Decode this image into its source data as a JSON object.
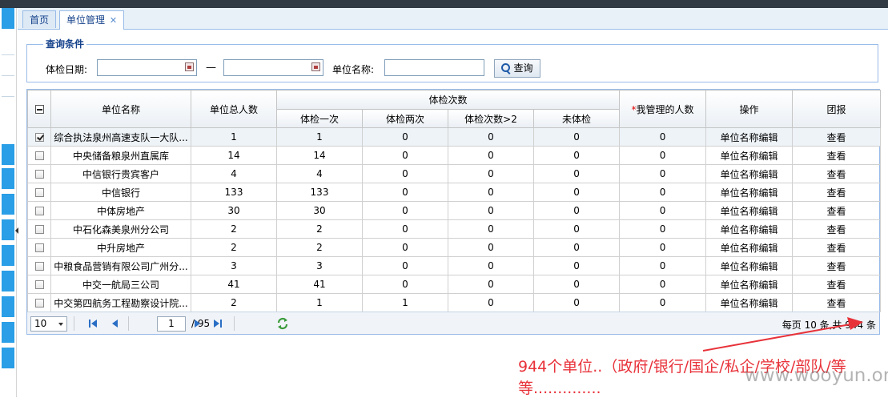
{
  "tabs": [
    {
      "label": "首页"
    },
    {
      "label": "单位管理",
      "close": "✕"
    }
  ],
  "query": {
    "legend": "查询条件",
    "date_label": "体检日期:",
    "date_from": "",
    "date_sep": "—",
    "date_to": "",
    "unit_label": "单位名称:",
    "unit_value": "",
    "search_button": "查询",
    "icons": [
      "calendar-icon",
      "search-icon"
    ]
  },
  "table": {
    "headers": {
      "unit_name": "单位名称",
      "total": "单位总人数",
      "exam_group": "体检次数",
      "once": "体检一次",
      "twice": "体检两次",
      "more": "体检次数>2",
      "none": "未体检",
      "mine_star": "*",
      "mine": "我管理的人数",
      "op": "操作",
      "report": "团报"
    },
    "rows": [
      {
        "checked": true,
        "name": "综合执法泉州高速支队一大队...",
        "total": "1",
        "once": "1",
        "twice": "0",
        "more": "0",
        "none": "0",
        "mine": "0",
        "op": "单位名称编辑",
        "report": "查看"
      },
      {
        "checked": false,
        "name": "中央储备粮泉州直属库",
        "total": "14",
        "once": "14",
        "twice": "0",
        "more": "0",
        "none": "0",
        "mine": "0",
        "op": "单位名称编辑",
        "report": "查看"
      },
      {
        "checked": false,
        "name": "中信银行贵宾客户",
        "total": "4",
        "once": "4",
        "twice": "0",
        "more": "0",
        "none": "0",
        "mine": "0",
        "op": "单位名称编辑",
        "report": "查看"
      },
      {
        "checked": false,
        "name": "中信银行",
        "total": "133",
        "once": "133",
        "twice": "0",
        "more": "0",
        "none": "0",
        "mine": "0",
        "op": "单位名称编辑",
        "report": "查看"
      },
      {
        "checked": false,
        "name": "中体房地产",
        "total": "30",
        "once": "30",
        "twice": "0",
        "more": "0",
        "none": "0",
        "mine": "0",
        "op": "单位名称编辑",
        "report": "查看"
      },
      {
        "checked": false,
        "name": "中石化森美泉州分公司",
        "total": "2",
        "once": "2",
        "twice": "0",
        "more": "0",
        "none": "0",
        "mine": "0",
        "op": "单位名称编辑",
        "report": "查看"
      },
      {
        "checked": false,
        "name": "中升房地产",
        "total": "2",
        "once": "2",
        "twice": "0",
        "more": "0",
        "none": "0",
        "mine": "0",
        "op": "单位名称编辑",
        "report": "查看"
      },
      {
        "checked": false,
        "name": "中粮食品营销有限公司广州分...",
        "total": "3",
        "once": "3",
        "twice": "0",
        "more": "0",
        "none": "0",
        "mine": "0",
        "op": "单位名称编辑",
        "report": "查看"
      },
      {
        "checked": false,
        "name": "中交一航局三公司",
        "total": "41",
        "once": "41",
        "twice": "0",
        "more": "0",
        "none": "0",
        "mine": "0",
        "op": "单位名称编辑",
        "report": "查看"
      },
      {
        "checked": false,
        "name": "中交第四航务工程勘察设计院...",
        "total": "2",
        "once": "1",
        "twice": "1",
        "more": "0",
        "none": "0",
        "mine": "0",
        "op": "单位名称编辑",
        "report": "查看"
      }
    ]
  },
  "pager": {
    "page_size": "10",
    "current_page": "1",
    "total_pages": "/ 95",
    "info": "每页 10 条,共 944 条"
  },
  "annotation": {
    "line1": "944个单位..（政府/银行/国企/私企/学校/部队/等",
    "line2": "等..............",
    "color": "#e8323a"
  },
  "watermark": "www.wooyun.org",
  "colors": {
    "accent": "#15428b",
    "border": "#99bbe8",
    "rail": "#2a9ee6"
  }
}
